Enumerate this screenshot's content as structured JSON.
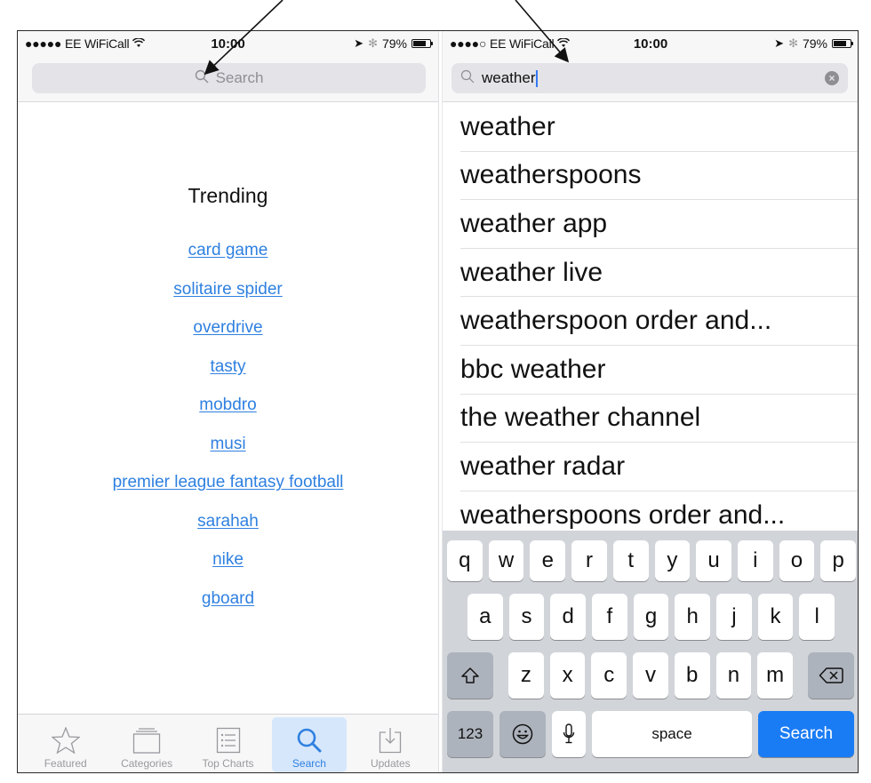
{
  "left_screen": {
    "status_bar": {
      "signal": "●●●●●",
      "carrier": "EE WiFiCall",
      "wifi_icon": "wifi-icon",
      "time": "10:00",
      "location_icon": "location-arrow-icon",
      "bluetooth_icon": "bluetooth-icon",
      "battery_percent": "79%",
      "battery_level": 0.79
    },
    "search": {
      "placeholder": "Search",
      "value": ""
    },
    "trending": {
      "title": "Trending",
      "items": [
        "card game",
        "solitaire spider",
        "overdrive",
        "tasty",
        "mobdro",
        "musi",
        "premier league fantasy football",
        "sarahah",
        "nike",
        "gboard"
      ]
    },
    "tab_bar": {
      "tabs": [
        {
          "label": "Featured",
          "icon": "star-icon",
          "active": false
        },
        {
          "label": "Categories",
          "icon": "categories-icon",
          "active": false
        },
        {
          "label": "Top Charts",
          "icon": "list-icon",
          "active": false
        },
        {
          "label": "Search",
          "icon": "search-icon",
          "active": true
        },
        {
          "label": "Updates",
          "icon": "download-icon",
          "active": false
        }
      ]
    }
  },
  "right_screen": {
    "status_bar": {
      "signal": "●●●●○",
      "carrier": "EE WiFiCall",
      "wifi_icon": "wifi-icon",
      "time": "10:00",
      "location_icon": "location-arrow-icon",
      "bluetooth_icon": "bluetooth-icon",
      "battery_percent": "79%",
      "battery_level": 0.79
    },
    "search": {
      "value": "weather",
      "clear_icon": "clear-icon"
    },
    "suggestions": [
      "weather",
      "weatherspoons",
      "weather app",
      "weather live",
      "weatherspoon order and...",
      "bbc weather",
      "the weather channel",
      "weather radar",
      "weatherspoons order and..."
    ],
    "keyboard": {
      "row1": [
        "q",
        "w",
        "e",
        "r",
        "t",
        "y",
        "u",
        "i",
        "o",
        "p"
      ],
      "row2": [
        "a",
        "s",
        "d",
        "f",
        "g",
        "h",
        "j",
        "k",
        "l"
      ],
      "row3": [
        "z",
        "x",
        "c",
        "v",
        "b",
        "n",
        "m"
      ],
      "shift_icon": "shift-icon",
      "delete_icon": "delete-icon",
      "numbers_label": "123",
      "emoji_icon": "emoji-icon",
      "mic_icon": "microphone-icon",
      "space_label": "space",
      "search_label": "Search"
    }
  },
  "colors": {
    "link_blue": "#2f80e0",
    "keyboard_search_blue": "#1a7cf5",
    "active_tab_bg": "#d6e7fb"
  }
}
